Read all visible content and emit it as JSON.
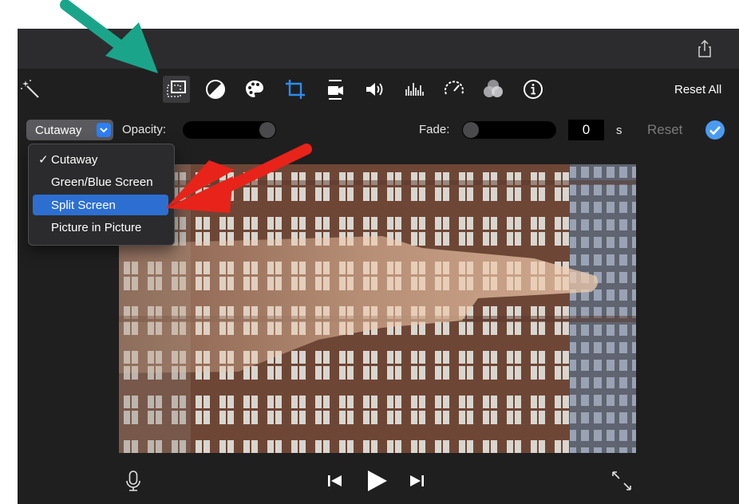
{
  "toolbar": {
    "reset_all_label": "Reset All",
    "icons": [
      "magic-wand-icon",
      "video-overlay-icon",
      "color-balance-icon",
      "color-palette-icon",
      "crop-icon",
      "stabilization-icon",
      "volume-icon",
      "equalizer-icon",
      "speed-icon",
      "clip-filter-icon",
      "info-icon"
    ]
  },
  "overlay": {
    "mode_selected": "Cutaway",
    "opacity_label": "Opacity:",
    "fade_label": "Fade:",
    "fade_value": "0",
    "fade_unit": "s",
    "reset_label": "Reset",
    "opacity_level": 1.0,
    "fade_level": 0.0
  },
  "menu": {
    "items": [
      {
        "label": "Cutaway",
        "checked": true
      },
      {
        "label": "Green/Blue Screen",
        "checked": false
      },
      {
        "label": "Split Screen",
        "highlighted": true
      },
      {
        "label": "Picture in Picture",
        "checked": false
      }
    ],
    "check_glyph": "✓"
  },
  "colors": {
    "accent": "#2d7ff2",
    "menu_highlight": "#2c6fd1",
    "annotation_green": "#1aa58a",
    "annotation_red": "#e8231a"
  }
}
